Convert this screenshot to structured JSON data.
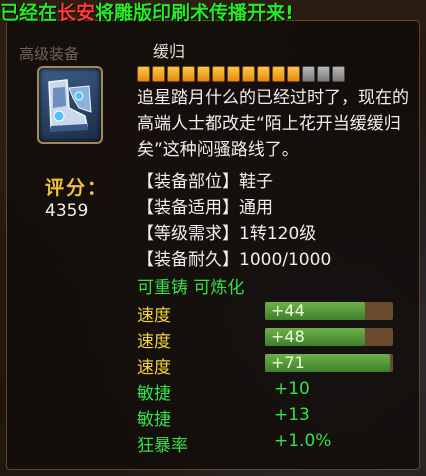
{
  "broadcast": {
    "before": "已经在",
    "place": "长安",
    "after": "将雕版印刷术传播开来!"
  },
  "tooltip": {
    "tab_name": "高级装备",
    "item_name": "缓归",
    "icon": "boots-icon",
    "stars": {
      "filled": 11,
      "total": 14
    },
    "description": "追星踏月什么的已经过时了，现在的高端人士都改走“陌上花开当缓缓归矣”这种闷骚路线了。",
    "score_label": "评分：",
    "score_value": "4359",
    "attributes": [
      {
        "text": "【装备部位】鞋子"
      },
      {
        "text": "【装备适用】通用"
      },
      {
        "text": "【等级需求】1转120级"
      },
      {
        "text": "【装备耐久】1000/1000"
      }
    ],
    "refine_text": "可重铸 可炼化",
    "stats": [
      {
        "label": "速度",
        "value": "+44",
        "bar": true,
        "fill": 0.78,
        "color": "yellow"
      },
      {
        "label": "速度",
        "value": "+48",
        "bar": true,
        "fill": 0.78,
        "color": "yellow"
      },
      {
        "label": "速度",
        "value": "+71",
        "bar": true,
        "fill": 0.98,
        "color": "yellow"
      },
      {
        "label": "敏捷",
        "value": "+10",
        "bar": false,
        "color": "green"
      },
      {
        "label": "敏捷",
        "value": "+13",
        "bar": false,
        "color": "green"
      },
      {
        "label": "狂暴率",
        "value": "+1.0%",
        "bar": false,
        "color": "green"
      }
    ]
  },
  "colors": {
    "broadcast_green": "#27e827",
    "broadcast_red": "#ff3b3b",
    "score_gold": "#f0c23a",
    "stat_green": "#35e04a",
    "stat_yellow": "#f2d43a",
    "bar_fill": "#4f9a36",
    "bar_track": "#6a4a2c"
  }
}
